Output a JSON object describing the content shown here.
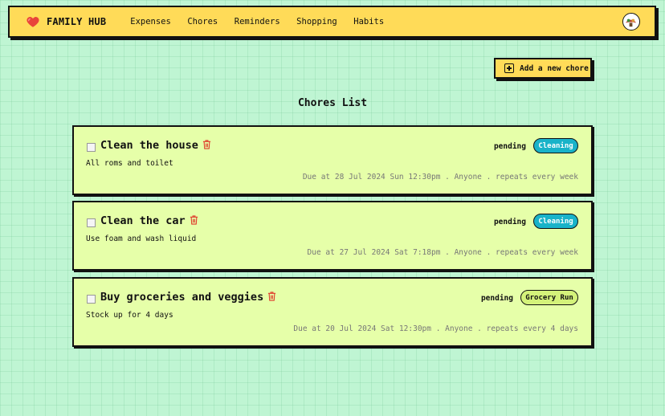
{
  "nav": {
    "brand": "FAMILY HUB",
    "links": [
      "Expenses",
      "Chores",
      "Reminders",
      "Shopping",
      "Habits"
    ]
  },
  "actions": {
    "add_chore": "Add a new chore"
  },
  "page": {
    "title": "Chores List"
  },
  "chores": [
    {
      "title": "Clean the house",
      "description": "All roms and toilet",
      "status": "pending",
      "tag": "Cleaning",
      "meta": "Due at 28 Jul 2024 Sun 12:30pm . Anyone . repeats every week"
    },
    {
      "title": "Clean the car",
      "description": "Use foam and wash liquid",
      "status": "pending",
      "tag": "Cleaning",
      "meta": "Due at 27 Jul 2024 Sat 7:18pm . Anyone . repeats every week"
    },
    {
      "title": "Buy groceries and veggies",
      "description": "Stock up for 4 days",
      "status": "pending",
      "tag": "Grocery Run",
      "meta": "Due at 20 Jul 2024 Sat 12:30pm . Anyone . repeats every 4 days"
    }
  ],
  "colors": {
    "background": "#bff5d3",
    "navbar": "#ffdb58",
    "card": "#e6ffa9",
    "tag_cleaning": "#19b3c9",
    "tag_grocery": "#d4f27a",
    "trash": "#e03b2b"
  },
  "icons": {
    "brand": "heart-icon",
    "add": "plus-square-icon",
    "delete": "trash-icon",
    "profile": "avatar"
  }
}
